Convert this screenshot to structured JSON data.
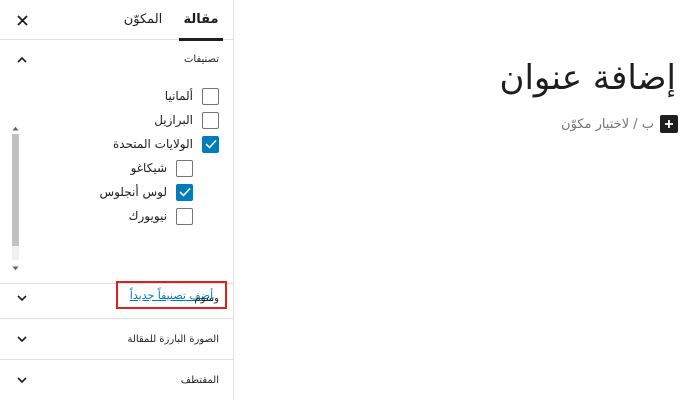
{
  "sidebar": {
    "tabs": {
      "post": "مقالة",
      "block": "المكوّن"
    },
    "close_icon": "close-icon",
    "categories": {
      "title": "تصنيفات",
      "items": [
        {
          "label": "ألمانيا",
          "checked": false,
          "child": false
        },
        {
          "label": "البرازيل",
          "checked": false,
          "child": false
        },
        {
          "label": "الولايات المتحدة",
          "checked": true,
          "child": false
        },
        {
          "label": "شيكاغو",
          "checked": false,
          "child": true
        },
        {
          "label": "لوس أنجلوس",
          "checked": true,
          "child": true
        },
        {
          "label": "نيويورك",
          "checked": false,
          "child": true
        }
      ],
      "add_new_label": "أضف تصنيفاً جديداً"
    },
    "panels": {
      "tags": "وسوم",
      "featured_image": "الصورة البارزة للمقالة",
      "excerpt": "المقتطف"
    }
  },
  "editor": {
    "title_placeholder": "إضافة عنوان",
    "block_prompt": "ب / لاختيار مكوّن"
  },
  "colors": {
    "accent": "#007cba",
    "highlight_border": "#e0201b",
    "text": "#1e1e1e",
    "muted": "#757575"
  }
}
